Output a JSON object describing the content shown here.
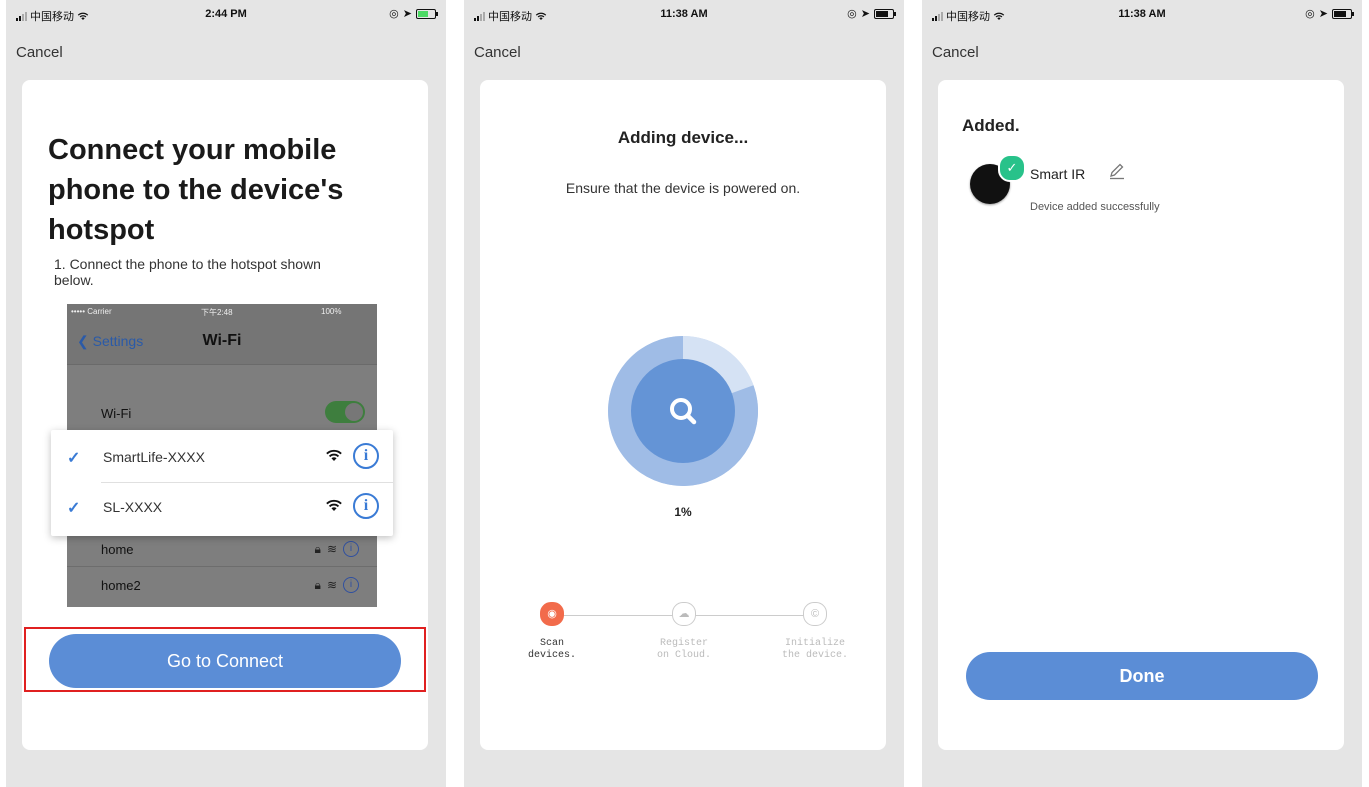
{
  "screens": [
    {
      "status": {
        "carrier": "中国移动",
        "time": "2:44 PM"
      },
      "cancel": "Cancel",
      "title": "Connect your mobile phone to the device's hotspot",
      "step": "1. Connect the phone to the hotspot shown below.",
      "phone": {
        "status_carrier": "••••• Carrier",
        "status_time": "下午2:48",
        "status_battery": "100%",
        "back_label": "Settings",
        "nav_title": "Wi-Fi",
        "wifi_label": "Wi-Fi",
        "networks": [
          "home",
          "home2"
        ]
      },
      "popup_networks": [
        "SmartLife-XXXX",
        "SL-XXXX"
      ],
      "button": "Go to Connect"
    },
    {
      "status": {
        "carrier": "中国移动",
        "time": "11:38 AM"
      },
      "cancel": "Cancel",
      "title": "Adding device...",
      "subtitle": "Ensure that the device is powered on.",
      "progress": "1%",
      "progress_value": 0.01,
      "steps": [
        {
          "label_line1": "Scan",
          "label_line2": "devices."
        },
        {
          "label_line1": "Register",
          "label_line2": "on Cloud."
        },
        {
          "label_line1": "Initialize",
          "label_line2": "the device."
        }
      ]
    },
    {
      "status": {
        "carrier": "中国移动",
        "time": "11:38 AM"
      },
      "cancel": "Cancel",
      "title": "Added.",
      "device_name": "Smart IR",
      "device_status": "Device added successfully",
      "button": "Done"
    }
  ],
  "colors": {
    "accent": "#5b8dd6",
    "scan_active": "#f26b4b",
    "success": "#28c28a",
    "highlight": "#e02020",
    "background": "#e5e5e5"
  },
  "icons": [
    "signal-icon",
    "wifi-icon",
    "location-icon",
    "battery-icon",
    "checkmark-icon",
    "info-icon",
    "search-icon",
    "cloud-icon",
    "edit-icon"
  ]
}
